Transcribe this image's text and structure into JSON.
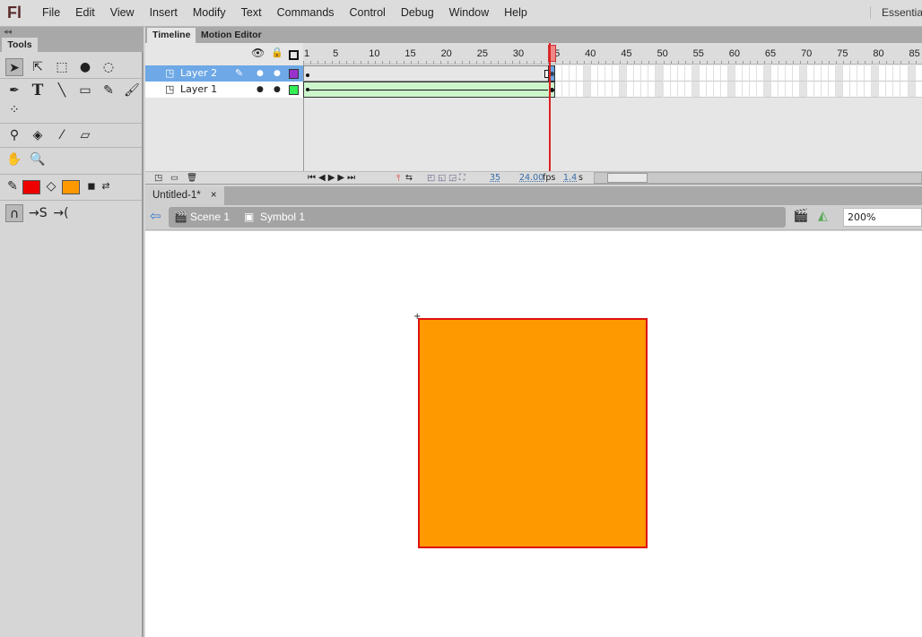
{
  "app": {
    "logo": "Fl",
    "menu": [
      "File",
      "Edit",
      "View",
      "Insert",
      "Modify",
      "Text",
      "Commands",
      "Control",
      "Debug",
      "Window",
      "Help"
    ],
    "workspace": "Essentials"
  },
  "tools": {
    "tab": "Tools",
    "collapse": "◂◂",
    "stroke_color": "#ee0000",
    "fill_color": "#ff9900",
    "items": [
      "selection-tool",
      "subselection-tool",
      "free-transform-tool",
      "3d-rotation-tool",
      "lasso-tool",
      "pen-tool",
      "text-tool",
      "line-tool",
      "rectangle-tool",
      "pencil-tool",
      "brush-tool",
      "deco-tool",
      "bone-tool",
      "paint-bucket-tool",
      "eyedropper-tool",
      "eraser-tool",
      "hand-tool",
      "zoom-tool"
    ]
  },
  "timeline": {
    "tabs": [
      "Timeline",
      "Motion Editor"
    ],
    "layers": [
      {
        "name": "Layer 2",
        "color": "#9933cc",
        "selected": true
      },
      {
        "name": "Layer 1",
        "color": "#33ee55",
        "selected": false
      }
    ],
    "frame_labels": [
      "1",
      "5",
      "10",
      "15",
      "20",
      "25",
      "30",
      "35",
      "40",
      "45",
      "50",
      "55",
      "60",
      "65",
      "70",
      "75",
      "80",
      "85"
    ],
    "current_frame": "35",
    "fps": "24.00",
    "fps_unit": "fps",
    "time": "1.4",
    "time_unit": "s",
    "tween": {
      "layer": "Layer 1",
      "start": 1,
      "end": 35,
      "type": "classic-tween",
      "color": "#ccf5cc"
    }
  },
  "document": {
    "tab": "Untitled-1*",
    "close": "×",
    "crumbs": [
      "Scene 1",
      "Symbol 1"
    ],
    "zoom": "200%",
    "shape": {
      "fill": "#ff9900",
      "stroke": "#dd1111"
    }
  }
}
